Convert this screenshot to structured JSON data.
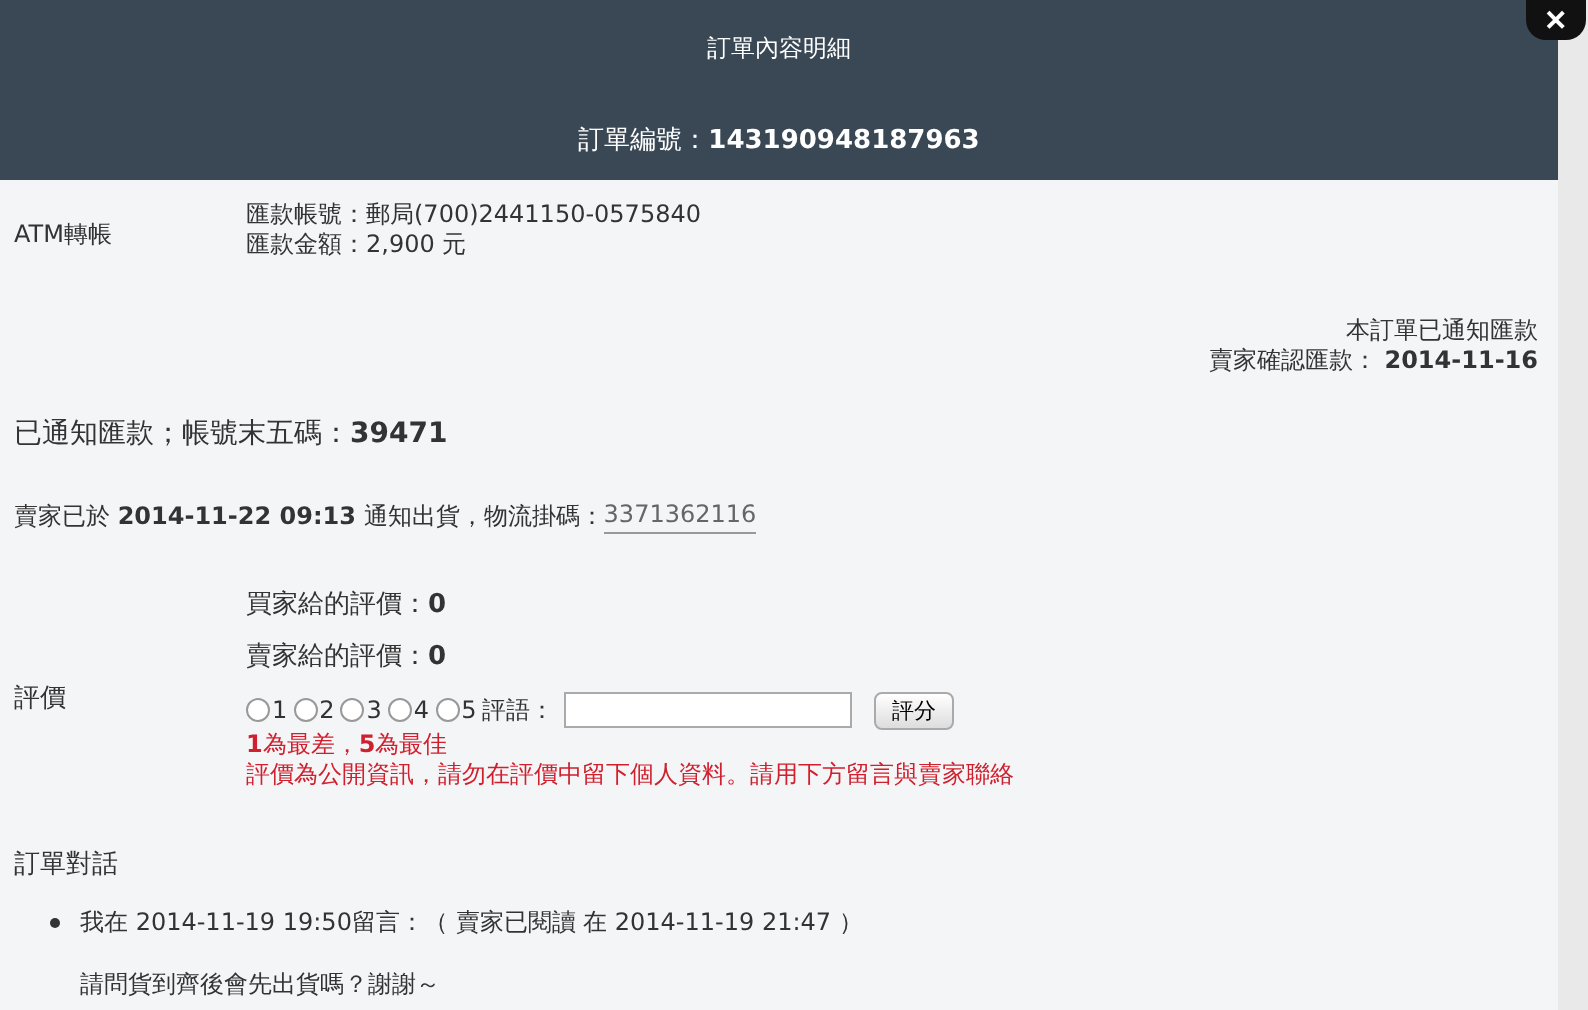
{
  "header": {
    "title": "訂單內容明細",
    "order_number": "訂單編號：**143190948187963**"
  },
  "close_button": {
    "label": "✕"
  },
  "payment": {
    "method": "ATM轉帳",
    "lines": [
      "匯款帳號：郵局(700)2441150-0575840",
      "匯款金額：2,900 元"
    ]
  },
  "payment_status": [
    "本訂單已通知匯款",
    "賣家確認匯款： **2014-11-16**"
  ],
  "notified": "已通知匯款；帳號末五碼：**39471**",
  "shipping": {
    "text": "賣家已於 **2014-11-22 09:13** 通知出貨，物流掛碼：",
    "tracking_link": "3371362116"
  },
  "rating": {
    "label": "評價",
    "buyer": "買家給的評價：**0**",
    "seller": "賣家給的評價：**0**",
    "options": [
      {
        "label": "1",
        "selected": false
      },
      {
        "label": "2",
        "selected": false
      },
      {
        "label": "3",
        "selected": false
      },
      {
        "label": "4",
        "selected": false
      },
      {
        "label": "5",
        "selected": false
      }
    ],
    "comment_label": "評語：",
    "submit": "評分",
    "hint": "**1**為最差，**5**為最佳",
    "warning": "評價為公開資訊，請勿在評價中留下個人資料。請用下方留言與賣家聯絡"
  },
  "conversation": {
    "title": "訂單對話",
    "messages": [
      {
        "meta": "我在 2014-11-19 19:50留言：（ 賣家已閱讀 在 2014-11-19 21:47 ）",
        "body": "請問貨到齊後會先出貨嗎？謝謝～"
      }
    ]
  }
}
